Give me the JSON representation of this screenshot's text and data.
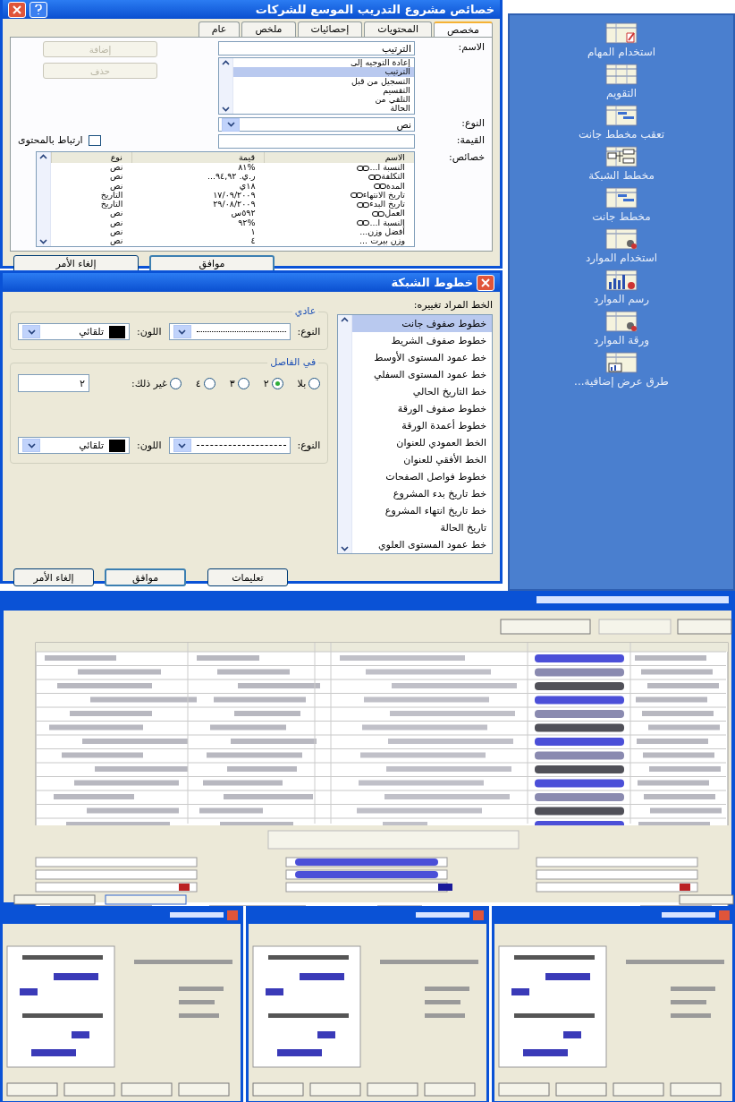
{
  "properties_dialog": {
    "title": "خصائص مشروع التدريب الموسع للشركات",
    "tabs": [
      {
        "label": "مخصص",
        "selected": true
      },
      {
        "label": "المحتويات",
        "selected": false
      },
      {
        "label": "إحصائيات",
        "selected": false
      },
      {
        "label": "ملخص",
        "selected": false
      },
      {
        "label": "عام",
        "selected": false
      }
    ],
    "name_label": "الاسم:",
    "name_value": "الترتيب",
    "name_list": [
      {
        "label": "إعادة التوجيه إلى",
        "selected": false
      },
      {
        "label": "الترتيب",
        "selected": true
      },
      {
        "label": "التسجيل من قبل",
        "selected": false
      },
      {
        "label": "التقسيم",
        "selected": false
      },
      {
        "label": "التلقي من",
        "selected": false
      },
      {
        "label": "الحالة",
        "selected": false
      }
    ],
    "type_label": "النوع:",
    "type_value": "نص",
    "value_label": "القيمة:",
    "link_checkbox": {
      "label": "ارتباط بالمحتوى",
      "checked": false
    },
    "add_button": {
      "label": "إضافة",
      "disabled": true
    },
    "delete_button": {
      "label": "حذف",
      "disabled": true
    },
    "properties_label": "خصائص:",
    "columns": [
      "الاسم",
      "قيمة",
      "نوع"
    ],
    "rows": [
      {
        "name": "النسبة ا...",
        "value": "%٨١",
        "type": "نص",
        "linked": true
      },
      {
        "name": "التكلفة",
        "value": "ر.ي. ٩٤,٩٢...",
        "type": "نص",
        "linked": true
      },
      {
        "name": "المدة",
        "value": "١٨ي",
        "type": "نص",
        "linked": true
      },
      {
        "name": "تاريخ الانتهاء",
        "value": "١٧/٠٩/٢٠٠٩",
        "type": "التاريخ",
        "linked": true
      },
      {
        "name": "تاريخ البدء",
        "value": "٢٩/٠٨/٢٠٠٩",
        "type": "التاريخ",
        "linked": true
      },
      {
        "name": "العمل",
        "value": "٥٩٢س",
        "type": "نص",
        "linked": true
      },
      {
        "name": "النسبة ا...",
        "value": "%٩٢",
        "type": "نص",
        "linked": true
      },
      {
        "name": "أفضل وزن...",
        "value": "١",
        "type": "نص",
        "linked": false
      },
      {
        "name": "وزن بيرت ...",
        "value": "٤",
        "type": "نص",
        "linked": false
      }
    ],
    "ok_button": "موافق",
    "cancel_button": "إلغاء الأمر"
  },
  "gridlines_dialog": {
    "title": "خطوط الشبكة",
    "list_label": "الخط المراد تغييره:",
    "lines": [
      {
        "label": "خطوط صفوف جانت",
        "selected": true
      },
      {
        "label": "خطوط صفوف الشريط",
        "selected": false
      },
      {
        "label": "خط عمود المستوى الأوسط",
        "selected": false
      },
      {
        "label": "خط عمود المستوى السفلي",
        "selected": false
      },
      {
        "label": "خط التاريخ الحالي",
        "selected": false
      },
      {
        "label": "خطوط صفوف الورقة",
        "selected": false
      },
      {
        "label": "خطوط أعمدة الورقة",
        "selected": false
      },
      {
        "label": "الخط العمودي للعنوان",
        "selected": false
      },
      {
        "label": "الخط الأفقي للعنوان",
        "selected": false
      },
      {
        "label": "خطوط فواصل الصفحات",
        "selected": false
      },
      {
        "label": "خط تاريخ بدء المشروع",
        "selected": false
      },
      {
        "label": "خط تاريخ انتهاء المشروع",
        "selected": false
      },
      {
        "label": "تاريخ الحالة",
        "selected": false
      },
      {
        "label": "خط عمود المستوى العلوي",
        "selected": false
      }
    ],
    "normal_group": {
      "title": "عادي",
      "type_label": "النوع:",
      "dashed": false,
      "color_label": "اللون:",
      "color_value": "تلقائي"
    },
    "interval_group": {
      "title": "في الفاصل",
      "options": [
        {
          "label": "بلا",
          "selected": false
        },
        {
          "label": "٢",
          "selected": true
        },
        {
          "label": "٣",
          "selected": false
        },
        {
          "label": "٤",
          "selected": false
        },
        {
          "label": "غير ذلك:",
          "selected": false
        }
      ],
      "other_value": "٢",
      "type_label": "النوع:",
      "dashed": true,
      "color_label": "اللون:",
      "color_value": "تلقائي"
    },
    "help_button": "تعليمات",
    "ok_button": "موافق",
    "cancel_button": "إلغاء الأمر"
  },
  "view_bar": {
    "items": [
      {
        "label": "استخدام المهام",
        "kind": "task-usage"
      },
      {
        "label": "التقويم",
        "kind": "calendar"
      },
      {
        "label": "تعقب مخطط جانت",
        "kind": "gantt"
      },
      {
        "label": "مخطط الشبكة",
        "kind": "network"
      },
      {
        "label": "مخطط جانت",
        "kind": "gantt"
      },
      {
        "label": "استخدام الموارد",
        "kind": "resource"
      },
      {
        "label": "رسم الموارد",
        "kind": "graph"
      },
      {
        "label": "ورقة الموارد",
        "kind": "resource"
      },
      {
        "label": "طرق عرض إضافية...",
        "kind": "more"
      }
    ]
  }
}
